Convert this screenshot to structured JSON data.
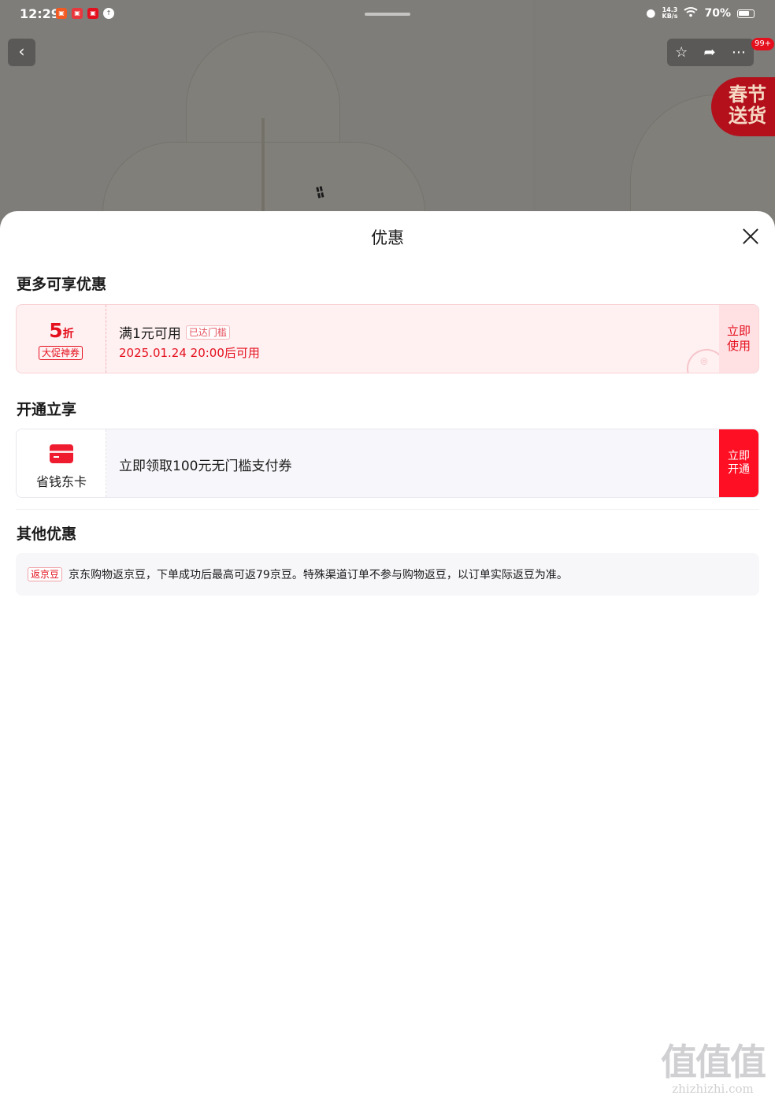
{
  "status_bar": {
    "time": "12:29",
    "net_speed_value": "14.3",
    "net_speed_unit": "KB/s",
    "battery": "70%"
  },
  "header": {
    "cart_badge": "99+",
    "festival_badge_line1": "春节",
    "festival_badge_line2": "送货"
  },
  "sheet": {
    "title": "优惠",
    "sections": {
      "more": "更多可享优惠",
      "open": "开通立享",
      "other": "其他优惠"
    },
    "coupon": {
      "value": "5",
      "unit": "折",
      "tag": "大促神券",
      "condition": "满1元可用",
      "threshold_tag": "已达门槛",
      "date": "2025.01.24 20:00后可用",
      "use_line1": "立即",
      "use_line2": "使用"
    },
    "member": {
      "name": "省钱东卡",
      "text": "立即领取100元无门槛支付券",
      "btn_line1": "立即",
      "btn_line2": "开通"
    },
    "other_promo": {
      "tag": "返京豆",
      "text": "京东购物返京豆，下单成功后最高可返79京豆。特殊渠道订单不参与购物返豆，以订单实际返豆为准。"
    }
  },
  "watermark": {
    "glyphs": "值值值",
    "url": "zhizhizhi.com"
  },
  "colors": {
    "accent_red": "#e4101e",
    "button_red": "#ff0f23",
    "coupon_bg": "#fff0f1"
  }
}
